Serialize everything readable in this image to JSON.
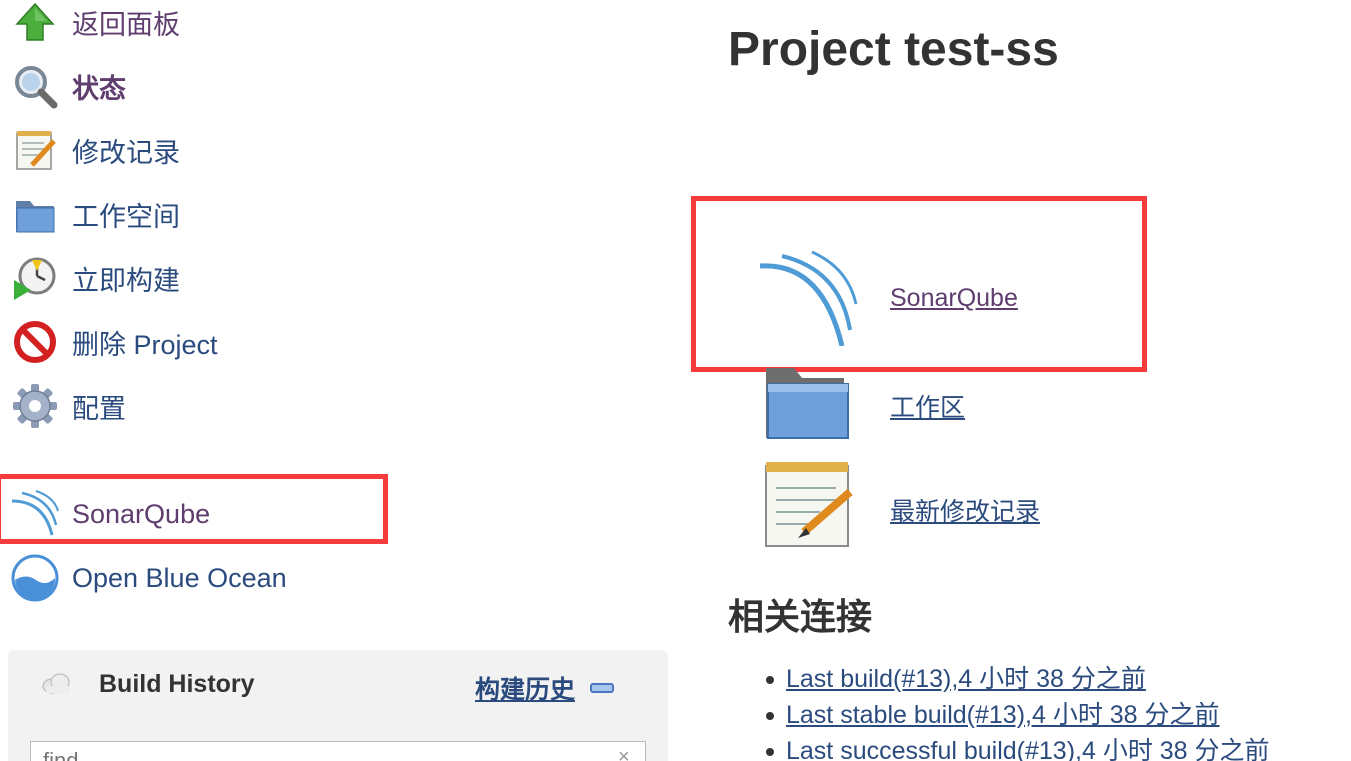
{
  "sidebar": {
    "items": [
      {
        "label": "返回面板",
        "icon": "up-arrow-icon"
      },
      {
        "label": "状态",
        "icon": "search-magnifier-icon"
      },
      {
        "label": "修改记录",
        "icon": "notepad-icon"
      },
      {
        "label": "工作空间",
        "icon": "folder-icon"
      },
      {
        "label": "立即构建",
        "icon": "build-clock-icon"
      },
      {
        "label": "删除 Project",
        "icon": "no-entry-icon"
      },
      {
        "label": "配置",
        "icon": "gear-icon"
      },
      {
        "label": "SonarQube",
        "icon": "sonarqube-icon"
      },
      {
        "label": "Open Blue Ocean",
        "icon": "blue-ocean-icon"
      }
    ]
  },
  "build_history": {
    "title": "Build History",
    "trend_label": "构建历史",
    "search_placeholder": "find"
  },
  "main": {
    "title": "Project test-ss",
    "links": [
      {
        "label": "SonarQube",
        "icon": "sonarqube-icon"
      },
      {
        "label": "工作区",
        "icon": "folder-icon"
      },
      {
        "label": "最新修改记录",
        "icon": "notepad-icon"
      }
    ],
    "permalinks_heading": "相关连接",
    "permalinks": [
      {
        "label": "Last build(#13),4 小时 38 分之前"
      },
      {
        "label": "Last stable build(#13),4 小时 38 分之前"
      },
      {
        "label": "Last successful build(#13),4 小时 38 分之前"
      }
    ]
  },
  "colors": {
    "highlight": "#f53b3b",
    "link": "#2b4b7e",
    "visited_link": "#5f3d6e",
    "sonar_blue": "#4e9bd5"
  }
}
